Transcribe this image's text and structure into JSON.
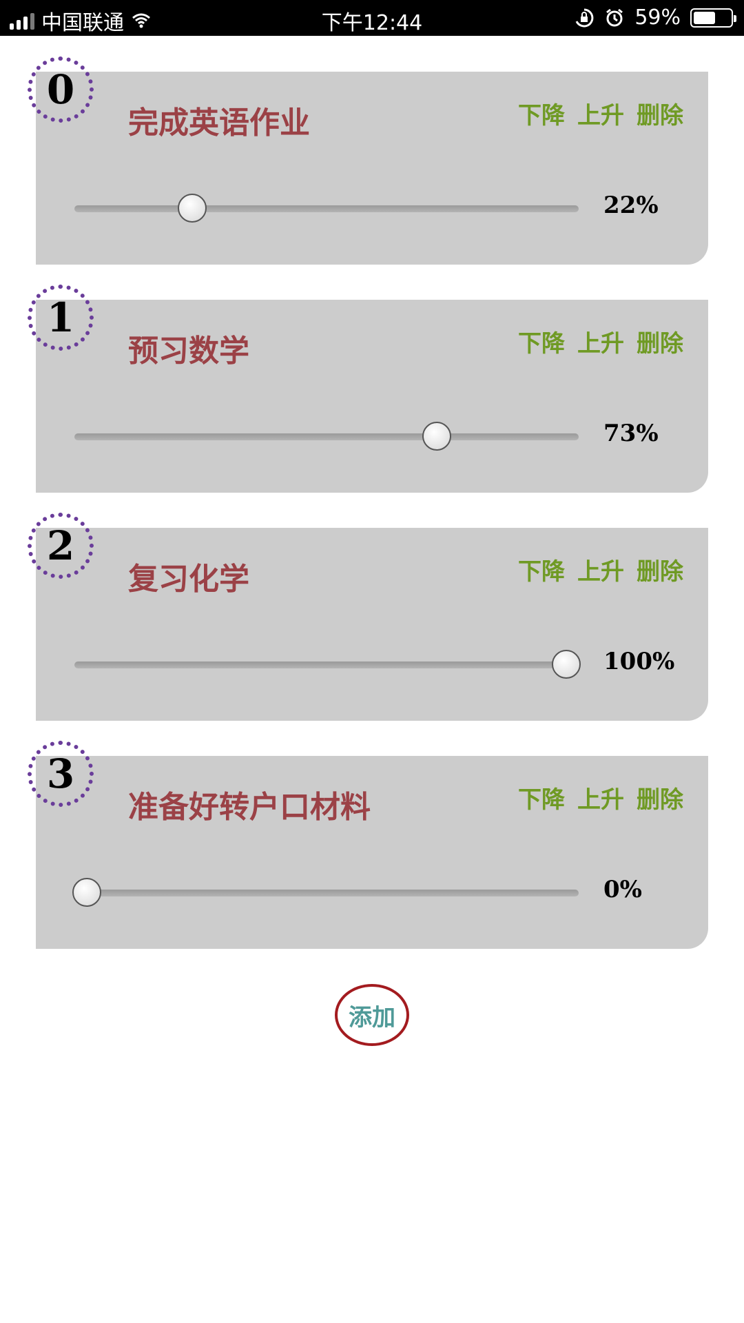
{
  "status_bar": {
    "carrier": "中国联通",
    "time": "下午12:44",
    "battery_percent": "59%",
    "battery_level": 0.59,
    "icons": [
      "signal-icon",
      "wifi-icon",
      "orientation-lock-icon",
      "alarm-icon",
      "battery-icon"
    ]
  },
  "tasks": [
    {
      "index": "0",
      "title": "完成英语作业",
      "down": "下降",
      "up": "上升",
      "delete": "删除",
      "progress_label": "22%",
      "progress": 22
    },
    {
      "index": "1",
      "title": "预习数学",
      "down": "下降",
      "up": "上升",
      "delete": "删除",
      "progress_label": "73%",
      "progress": 73
    },
    {
      "index": "2",
      "title": "复习化学",
      "down": "下降",
      "up": "上升",
      "delete": "删除",
      "progress_label": "100%",
      "progress": 100
    },
    {
      "index": "3",
      "title": "准备好转户口材料",
      "down": "下降",
      "up": "上升",
      "delete": "删除",
      "progress_label": "0%",
      "progress": 0
    }
  ],
  "add_label": "添加",
  "colors": {
    "card_bg": "#cccccc",
    "title": "#9b4146",
    "action": "#6f9a24",
    "badge_border": "#6a3d9a",
    "add_border": "#a31b1f",
    "add_text": "#4f9a98"
  }
}
